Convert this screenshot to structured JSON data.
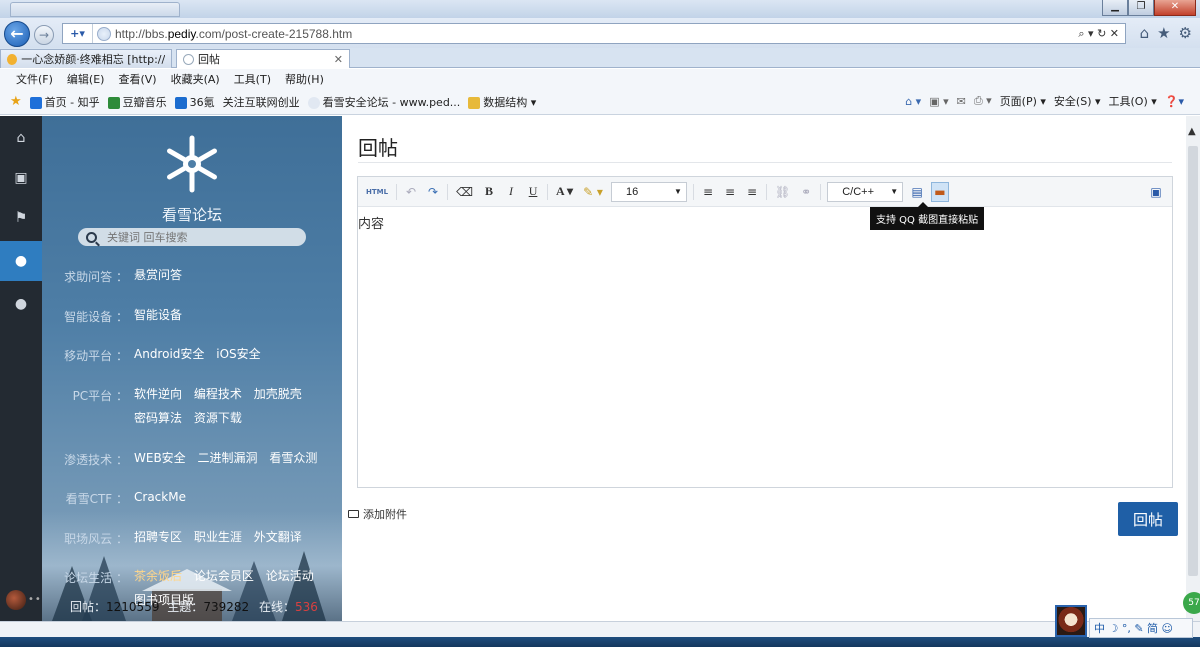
{
  "browser": {
    "url_prefix": "http://bbs.",
    "url_host": "pediy",
    "url_suffix": ".com/post-create-215788.htm",
    "tabs": [
      {
        "label": "一心念娇颜·终难相忘 [http://...",
        "active": false
      },
      {
        "label": "回帖",
        "active": true
      }
    ],
    "menu": [
      "文件(F)",
      "编辑(E)",
      "查看(V)",
      "收藏夹(A)",
      "工具(T)",
      "帮助(H)"
    ],
    "favorites": [
      "首页 - 知乎",
      "豆瓣音乐",
      "36氪",
      "关注互联网创业",
      "看雪安全论坛 - www.ped...",
      "数据结构 ▾"
    ],
    "commands": [
      "页面(P) ▾",
      "安全(S) ▾",
      "工具(O) ▾"
    ]
  },
  "sidebar": {
    "site_name": "看雪论坛",
    "search_placeholder": "关键词 回车搜索",
    "categories": [
      {
        "label": "求助问答 ：",
        "links": [
          {
            "text": "悬赏问答",
            "hl": false
          }
        ]
      },
      {
        "label": "智能设备 ：",
        "links": [
          {
            "text": "智能设备",
            "hl": false
          }
        ]
      },
      {
        "label": "移动平台 ：",
        "links": [
          {
            "text": "Android安全",
            "hl": false
          },
          {
            "text": "iOS安全",
            "hl": false
          }
        ]
      },
      {
        "label": "PC平台 ：",
        "links": [
          {
            "text": "软件逆向",
            "hl": false
          },
          {
            "text": "编程技术",
            "hl": false
          },
          {
            "text": "加壳脱壳",
            "hl": false
          },
          {
            "text": "密码算法",
            "hl": false
          },
          {
            "text": "资源下载",
            "hl": false
          }
        ]
      },
      {
        "label": "渗透技术 ：",
        "links": [
          {
            "text": "WEB安全",
            "hl": false
          },
          {
            "text": "二进制漏洞",
            "hl": false
          },
          {
            "text": "看雪众测",
            "hl": false
          }
        ]
      },
      {
        "label": "看雪CTF ：",
        "links": [
          {
            "text": "CrackMe",
            "hl": false
          }
        ]
      },
      {
        "label": "职场风云 ：",
        "links": [
          {
            "text": "招聘专区",
            "hl": false
          },
          {
            "text": "职业生涯",
            "hl": false
          },
          {
            "text": "外文翻译",
            "hl": false
          }
        ]
      },
      {
        "label": "论坛生活 ：",
        "links": [
          {
            "text": "茶余饭后",
            "hl": true
          },
          {
            "text": "论坛会员区",
            "hl": false
          },
          {
            "text": "论坛活动",
            "hl": false
          },
          {
            "text": "图书项目版",
            "hl": false
          }
        ]
      }
    ],
    "stats": {
      "replies_label": "回帖：",
      "replies": "1210559",
      "topics_label": "主题：",
      "topics": "739282",
      "online_label": "在线：",
      "online": "536"
    }
  },
  "content": {
    "title": "回帖",
    "font_size": "16",
    "code_lang": "C/C++",
    "editor_text": "内容",
    "tooltip": "支持 QQ 截图直接粘贴",
    "attach_label": "添加附件",
    "submit_label": "回帖"
  },
  "ime": {
    "text": "中 ☽ °, ✎ 简 ☺"
  },
  "badge": "57"
}
